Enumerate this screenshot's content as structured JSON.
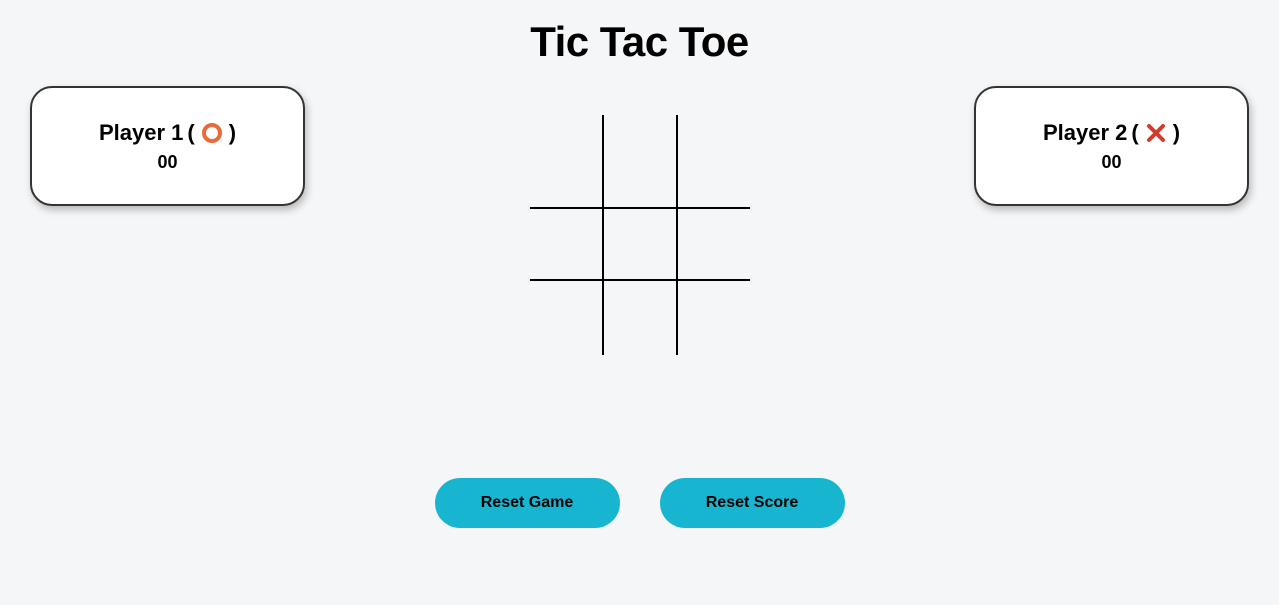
{
  "title": "Tic Tac Toe",
  "player1": {
    "label": "Player 1",
    "score": "00"
  },
  "player2": {
    "label": "Player 2",
    "score": "00"
  },
  "buttons": {
    "reset_game": "Reset Game",
    "reset_score": "Reset Score"
  },
  "colors": {
    "accent": "#17b5d0",
    "o_stroke": "#e96b3a",
    "x_stroke": "#d13c2e"
  }
}
